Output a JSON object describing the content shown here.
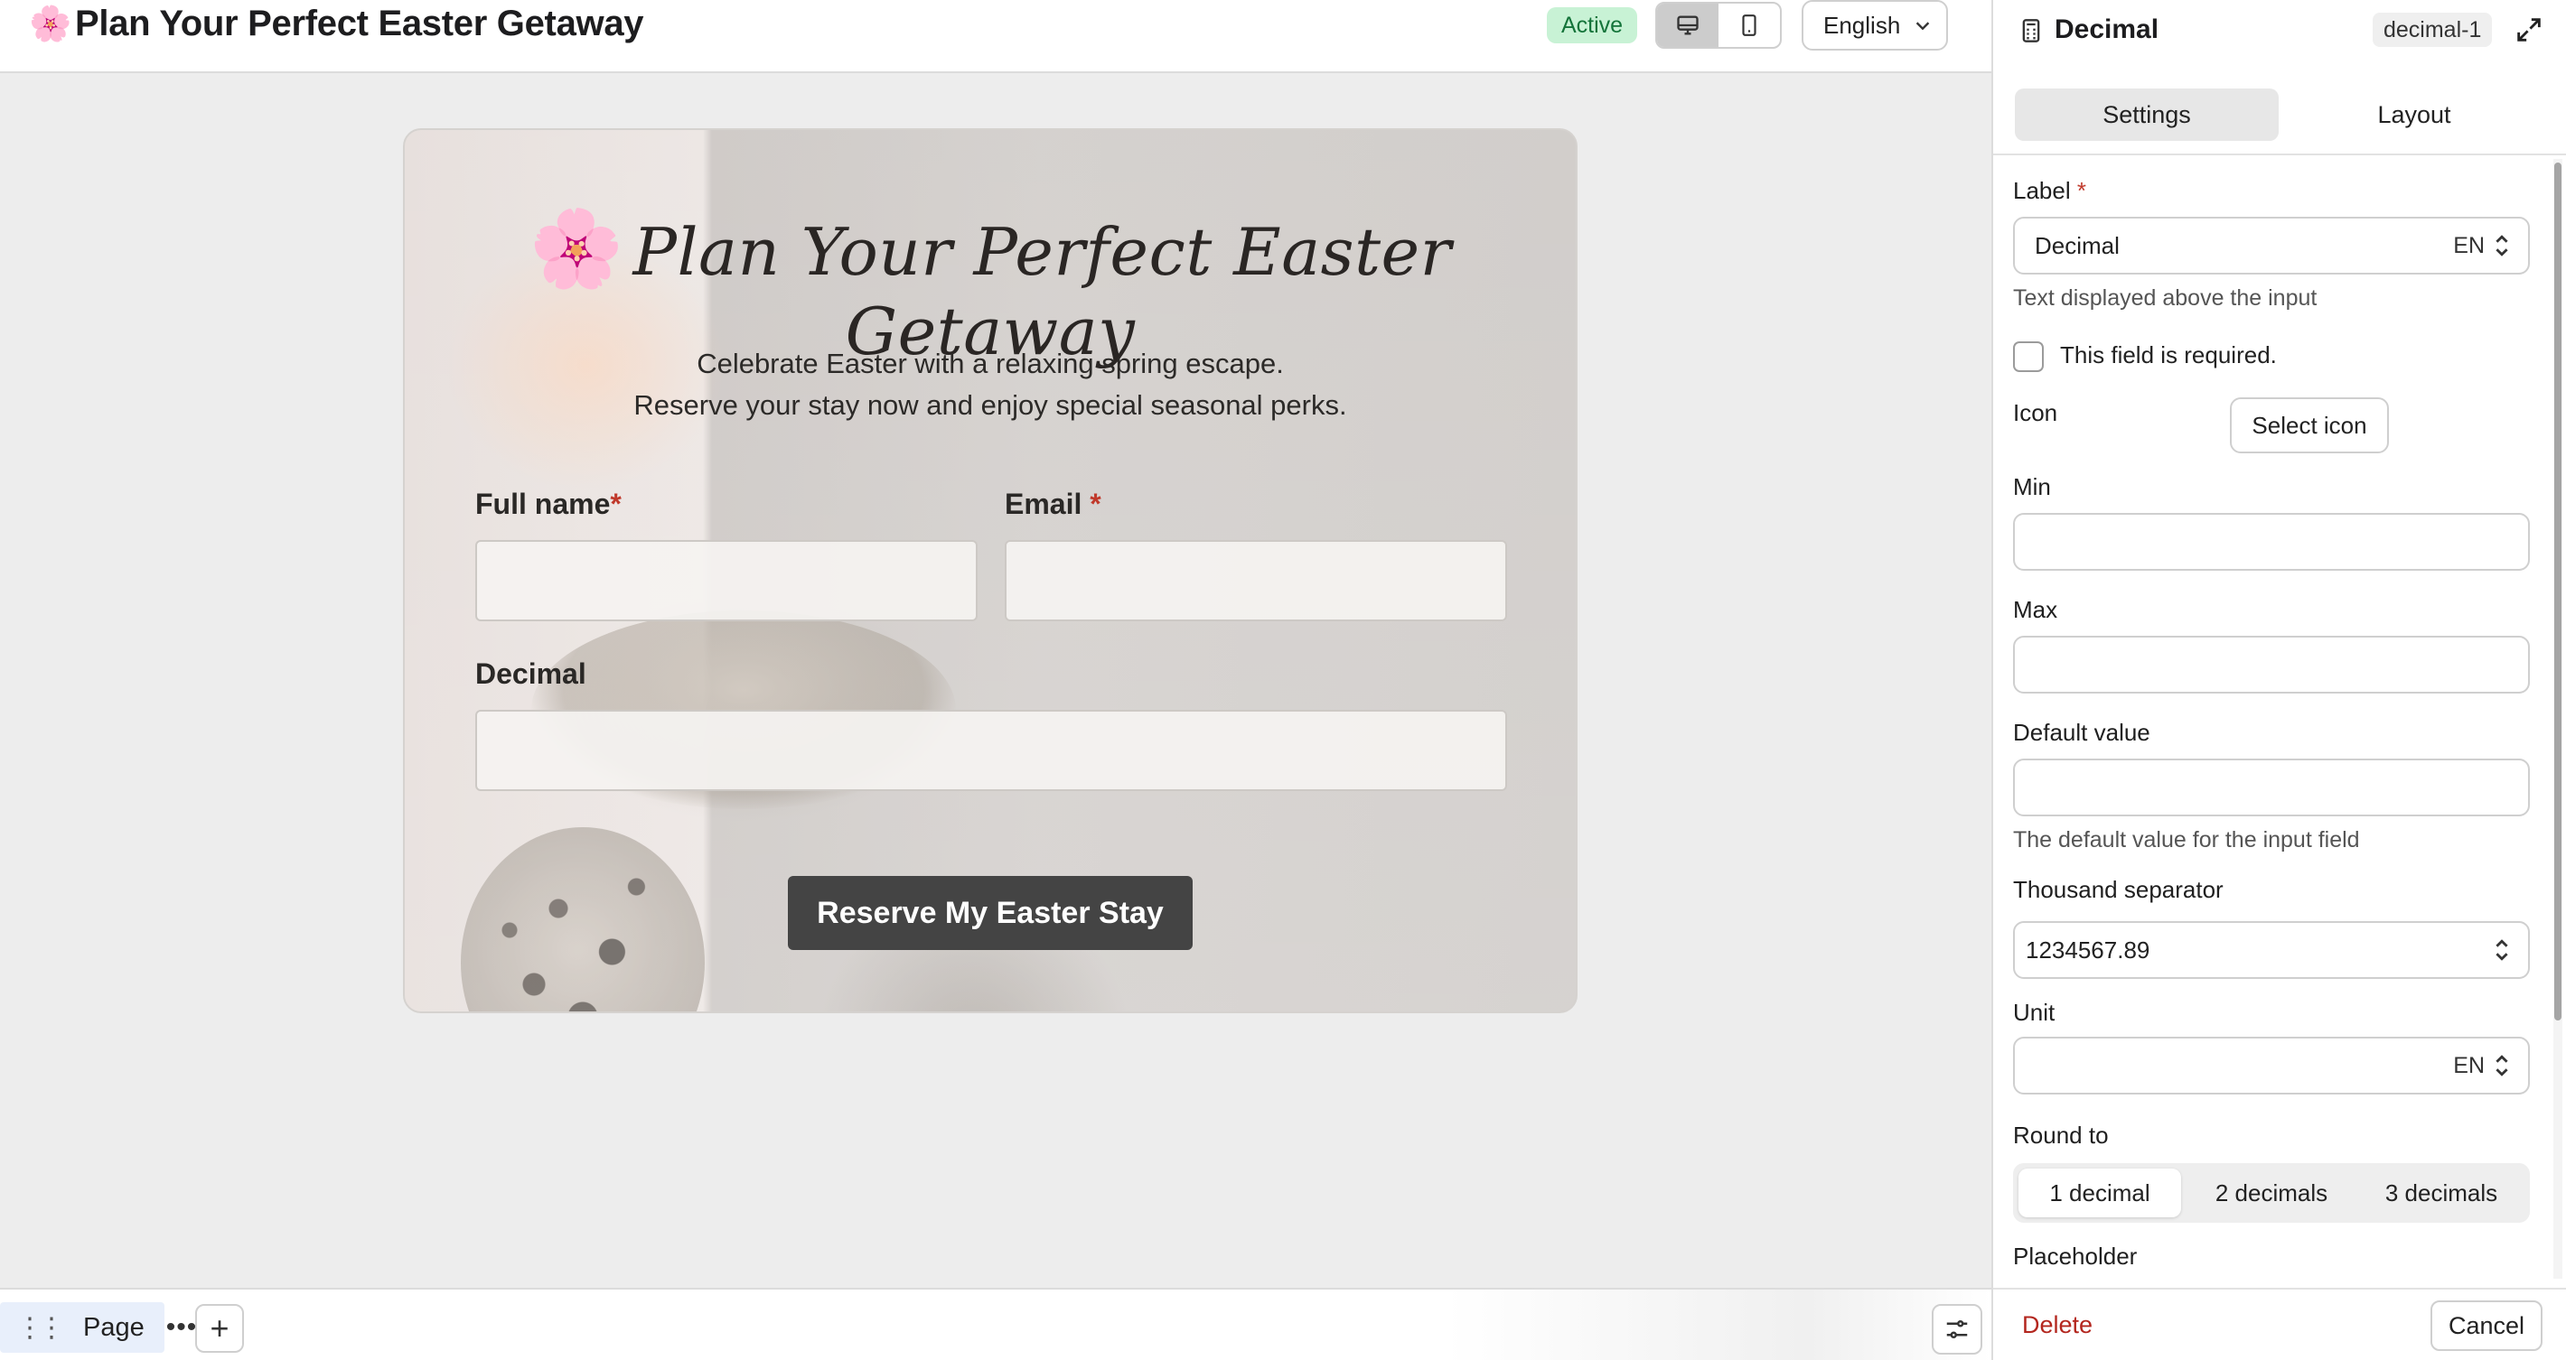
{
  "header": {
    "title_emoji": "🌸",
    "title": "Plan Your Perfect Easter Getaway",
    "status_badge": "Active",
    "language": "English"
  },
  "form": {
    "title_emoji": "🌸",
    "title": "Plan Your Perfect Easter Getaway",
    "subtitle_line1": "Celebrate Easter with a relaxing spring escape.",
    "subtitle_line2": "Reserve your stay now and enjoy special seasonal perks.",
    "fields": {
      "full_name_label": "Full name",
      "email_label": "Email",
      "decimal_label": "Decimal",
      "required_mark": "*"
    },
    "submit_label": "Reserve My Easter Stay"
  },
  "bottom_bar": {
    "page_label": "Page",
    "more_label": "•••",
    "add_label": "+"
  },
  "panel": {
    "title": "Decimal",
    "field_id": "decimal-1",
    "tabs": [
      "Settings",
      "Layout"
    ],
    "active_tab": "Settings",
    "label_field": {
      "label": "Label",
      "required_mark": "*",
      "value": "Decimal",
      "locale": "EN",
      "help": "Text displayed above the input"
    },
    "required_checkbox": {
      "label": "This field is required.",
      "checked": false
    },
    "icon": {
      "label": "Icon",
      "button": "Select icon"
    },
    "min": {
      "label": "Min",
      "value": ""
    },
    "max": {
      "label": "Max",
      "value": ""
    },
    "default_value": {
      "label": "Default value",
      "value": "",
      "help": "The default value for the input field"
    },
    "thousand_separator": {
      "label": "Thousand separator",
      "value": "1234567.89"
    },
    "unit": {
      "label": "Unit",
      "value": "",
      "locale": "EN"
    },
    "round_to": {
      "label": "Round to",
      "options": [
        "1 decimal",
        "2 decimals",
        "3 decimals"
      ],
      "selected": "1 decimal"
    },
    "placeholder": {
      "label": "Placeholder"
    },
    "footer": {
      "delete": "Delete",
      "cancel": "Cancel"
    }
  }
}
